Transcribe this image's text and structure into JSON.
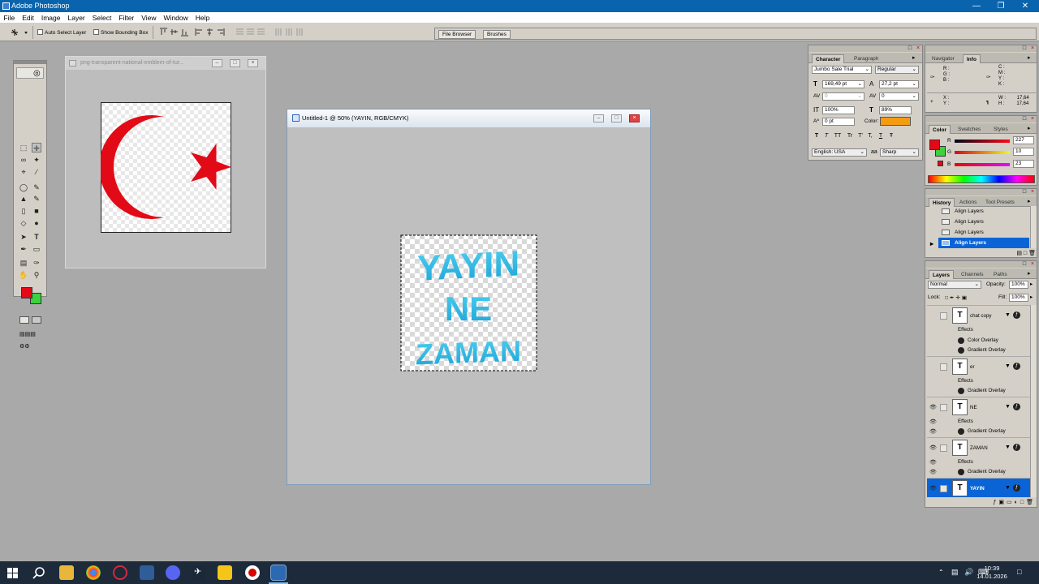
{
  "app": {
    "title": "Adobe Photoshop"
  },
  "menu": [
    "File",
    "Edit",
    "Image",
    "Layer",
    "Select",
    "Filter",
    "View",
    "Window",
    "Help"
  ],
  "options": {
    "auto_select_label": "Auto Select Layer",
    "show_bbox_label": "Show Bounding Box"
  },
  "palette_well": {
    "tabs": [
      "File Browser",
      "Brushes"
    ]
  },
  "doc_emblem": {
    "title": "png-transparent-national-emblem-of-tur..."
  },
  "doc_main": {
    "title": "Untitled-1 @ 50% (YAYIN, RGB/CMYK)",
    "lines": [
      "YAYIN",
      "NE",
      "ZAMAN"
    ]
  },
  "character": {
    "tabs": [
      "Character",
      "Paragraph"
    ],
    "font": "Jumbo Sale Trial",
    "style": "Regular",
    "size": "169,49 pt",
    "leading": "27,2 pt",
    "kerning": "0",
    "tracking": "0",
    "vscale": "100%",
    "hscale": "89%",
    "baseline": "0 pt",
    "color_label": "Color:",
    "language": "English: USA",
    "aa_label": "a",
    "antialias": "Sharp",
    "type_buttons": [
      "T",
      "T",
      "TT",
      "Tr",
      "T'",
      "T,",
      "T",
      "Ŧ"
    ],
    "text_color": "#f39c12"
  },
  "navinfo": {
    "tabs": [
      "Navigator",
      "Info"
    ],
    "rgb_labels": [
      "R :",
      "G :",
      "B :"
    ],
    "cmyk_labels": [
      "C :",
      "M :",
      "Y :",
      "K :"
    ],
    "xy_labels": [
      "X :",
      "Y :"
    ],
    "wh_labels": [
      "W :",
      "H :"
    ],
    "w": "17,64",
    "h": "17,64"
  },
  "color": {
    "tabs": [
      "Color",
      "Swatches",
      "Styles"
    ],
    "channels": [
      {
        "label": "R",
        "value": "227"
      },
      {
        "label": "G",
        "value": "10"
      },
      {
        "label": "B",
        "value": "23"
      }
    ],
    "fg": "#e30a17",
    "bg": "#3cd23c"
  },
  "history": {
    "tabs": [
      "History",
      "Actions",
      "Tool Presets"
    ],
    "items": [
      "Align Layers",
      "Align Layers",
      "Align Layers",
      "Align Layers"
    ]
  },
  "layers": {
    "tabs": [
      "Layers",
      "Channels",
      "Paths"
    ],
    "blend": "Normal",
    "opacity_label": "Opacity:",
    "opacity": "100%",
    "lock_label": "Lock:",
    "fill_label": "Fill:",
    "fill": "100%",
    "rows": [
      {
        "kind": "layer",
        "name": "chat copy",
        "eye": false
      },
      {
        "kind": "effects",
        "name": "Effects",
        "eye": false
      },
      {
        "kind": "effect",
        "name": "Color Overlay",
        "eye": false
      },
      {
        "kind": "effect",
        "name": "Gradient Overlay",
        "eye": false
      },
      {
        "kind": "layer",
        "name": "er",
        "eye": false
      },
      {
        "kind": "effects",
        "name": "Effects",
        "eye": false
      },
      {
        "kind": "effect",
        "name": "Gradient Overlay",
        "eye": false
      },
      {
        "kind": "layer",
        "name": "NE",
        "eye": true
      },
      {
        "kind": "effects",
        "name": "Effects",
        "eye": true
      },
      {
        "kind": "effect",
        "name": "Gradient Overlay",
        "eye": true
      },
      {
        "kind": "layer",
        "name": "ZAMAN",
        "eye": true
      },
      {
        "kind": "effects",
        "name": "Effects",
        "eye": true
      },
      {
        "kind": "effect",
        "name": "Gradient Overlay",
        "eye": true
      },
      {
        "kind": "layer",
        "name": "YAYIN",
        "eye": true
      }
    ]
  },
  "tools": {
    "fg": "#e30a17",
    "bg": "#3cd23c"
  },
  "taskbar": {
    "time": "10:39",
    "date": "14.01.2026"
  }
}
